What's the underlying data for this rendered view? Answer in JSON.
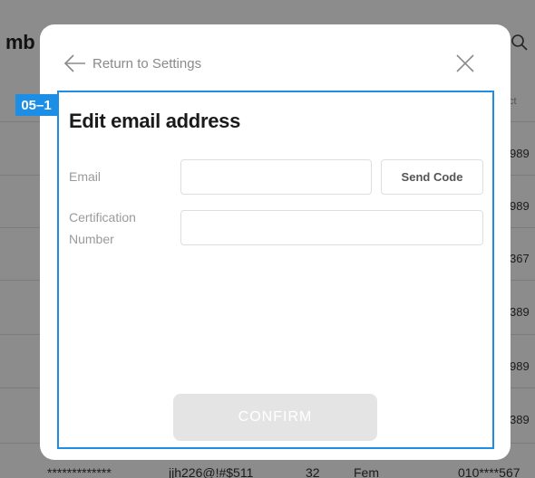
{
  "background": {
    "page_title": "mb",
    "column_header": "ct",
    "phone_cells": [
      "989",
      "989",
      "367",
      "389",
      "989",
      "389"
    ],
    "bottom_row": {
      "name": "*************",
      "email": "jjh226@!#$511",
      "age": "32",
      "gender": "Fem",
      "phone": "010****567"
    }
  },
  "modal": {
    "back_label": "Return to Settings",
    "title": "Edit email address",
    "annotation_tag": "05–1",
    "email_label": "Email",
    "email_value": "",
    "send_code_label": "Send Code",
    "cert_label_line1": "Certification",
    "cert_label_line2": "Number",
    "cert_value": "",
    "confirm_label": "CONFIRM"
  },
  "colors": {
    "accent": "#1c8ee6",
    "disabled_button": "#e4e4e4"
  },
  "icons": [
    "search-icon",
    "arrow-left-icon",
    "close-icon"
  ]
}
